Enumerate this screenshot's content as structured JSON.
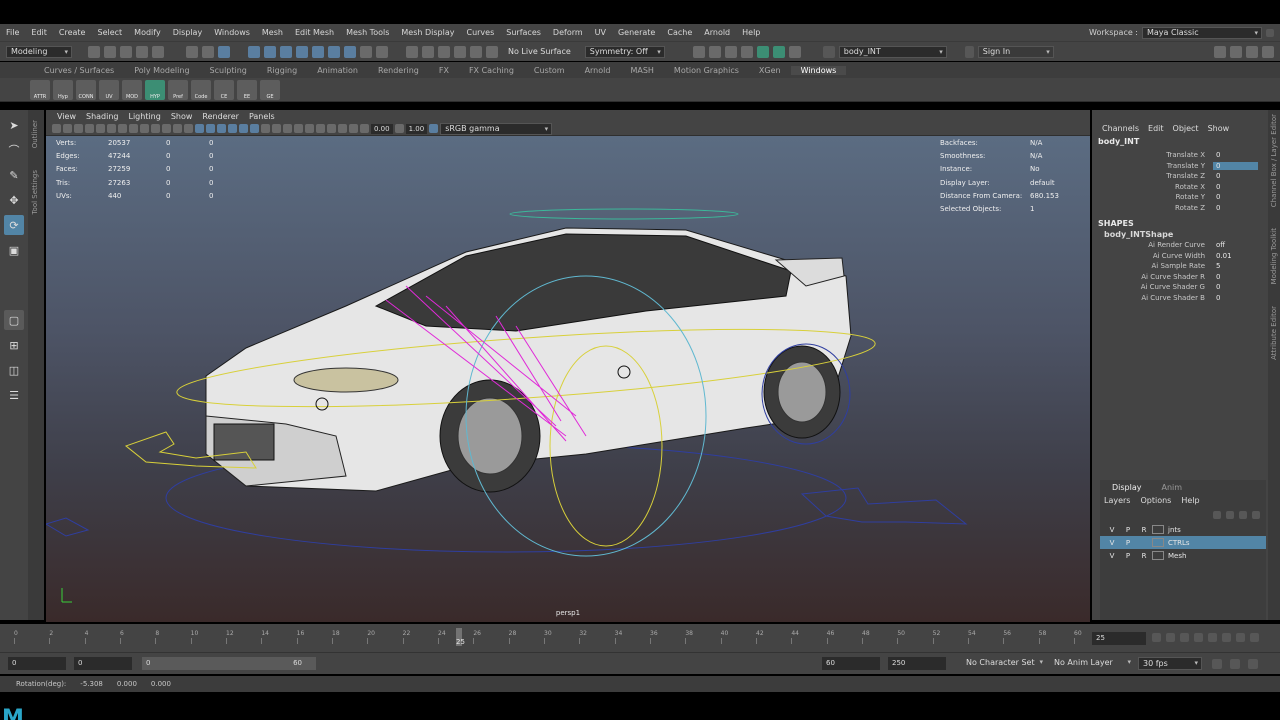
{
  "menu": [
    "File",
    "Edit",
    "Create",
    "Select",
    "Modify",
    "Display",
    "Windows",
    "Mesh",
    "Edit Mesh",
    "Mesh Tools",
    "Mesh Display",
    "Curves",
    "Surfaces",
    "Deform",
    "UV",
    "Generate",
    "Cache",
    "Arnold",
    "Help"
  ],
  "workspace": {
    "label": "Workspace :",
    "value": "Maya Classic"
  },
  "status": {
    "mode": "Modeling",
    "live_surface": "No Live Surface",
    "symmetry": "Symmetry: Off",
    "object_name": "body_INT",
    "sign_in": "Sign In"
  },
  "shelf_tabs": [
    "Curves / Surfaces",
    "Poly Modeling",
    "Sculpting",
    "Rigging",
    "Animation",
    "Rendering",
    "FX",
    "FX Caching",
    "Custom",
    "Arnold",
    "MASH",
    "Motion Graphics",
    "XGen",
    "Windows"
  ],
  "shelf_active": "Windows",
  "shelf_icons": [
    "ATTR",
    "Hyp",
    "CONN",
    "UV",
    "MOD",
    "HYP",
    "Pref",
    "Code",
    "CE",
    "EE",
    "GE"
  ],
  "side_labels": {
    "outliner": "Outliner",
    "tool_settings": "Tool Settings"
  },
  "viewport": {
    "menu": [
      "View",
      "Shading",
      "Lighting",
      "Show",
      "Renderer",
      "Panels"
    ],
    "near": "0.00",
    "far": "1.00",
    "color_space": "sRGB gamma",
    "camera": "persp1",
    "stats": [
      {
        "k": "Verts:",
        "a": "20537",
        "b": "0",
        "c": "0"
      },
      {
        "k": "Edges:",
        "a": "47244",
        "b": "0",
        "c": "0"
      },
      {
        "k": "Faces:",
        "a": "27259",
        "b": "0",
        "c": "0"
      },
      {
        "k": "Tris:",
        "a": "27263",
        "b": "0",
        "c": "0"
      },
      {
        "k": "UVs:",
        "a": "440",
        "b": "0",
        "c": "0"
      }
    ],
    "info": [
      {
        "k": "Backfaces:",
        "v": "N/A"
      },
      {
        "k": "Smoothness:",
        "v": "N/A"
      },
      {
        "k": "Instance:",
        "v": "No"
      },
      {
        "k": "Display Layer:",
        "v": "default"
      },
      {
        "k": "Distance From Camera:",
        "v": "680.153"
      },
      {
        "k": "Selected Objects:",
        "v": "1"
      }
    ]
  },
  "channel_box": {
    "menu": [
      "Channels",
      "Edit",
      "Object",
      "Show"
    ],
    "node": "body_INT",
    "attrs": [
      {
        "n": "Translate X",
        "v": "0"
      },
      {
        "n": "Translate Y",
        "v": "0"
      },
      {
        "n": "Translate Z",
        "v": "0"
      },
      {
        "n": "Rotate X",
        "v": "0"
      },
      {
        "n": "Rotate Y",
        "v": "0"
      },
      {
        "n": "Rotate Z",
        "v": "0"
      }
    ],
    "shapes_header": "SHAPES",
    "shape_node": "body_INTShape",
    "shape_attrs": [
      {
        "n": "Ai Render Curve",
        "v": "off"
      },
      {
        "n": "Ai Curve Width",
        "v": "0.01"
      },
      {
        "n": "Ai Sample Rate",
        "v": "5"
      },
      {
        "n": "Ai Curve Shader R",
        "v": "0"
      },
      {
        "n": "Ai Curve Shader G",
        "v": "0"
      },
      {
        "n": "Ai Curve Shader B",
        "v": "0"
      }
    ]
  },
  "right_tabs": [
    "Channel Box / Layer Editor",
    "Modeling Toolkit",
    "Attribute Editor"
  ],
  "layers": {
    "tabs": [
      "Display",
      "Anim"
    ],
    "menu": [
      "Layers",
      "Options",
      "Help"
    ],
    "rows": [
      {
        "v": "V",
        "p": "P",
        "r": "R",
        "name": "jnts",
        "selected": false
      },
      {
        "v": "V",
        "p": "P",
        "r": "",
        "name": "CTRLs",
        "selected": true
      },
      {
        "v": "V",
        "p": "P",
        "r": "R",
        "name": "Mesh",
        "selected": false
      }
    ]
  },
  "timeline": {
    "ticks": [
      "0",
      "2",
      "4",
      "6",
      "8",
      "10",
      "12",
      "14",
      "16",
      "18",
      "20",
      "22",
      "24",
      "26",
      "28",
      "30",
      "32",
      "34",
      "36",
      "38",
      "40",
      "42",
      "44",
      "46",
      "48",
      "50",
      "52",
      "54",
      "56",
      "58",
      "60"
    ],
    "current": "25",
    "current_field": "25"
  },
  "range": {
    "start": "0",
    "playback_start": "0",
    "slider_start": "0",
    "slider_end": "60",
    "playback_end": "60",
    "end": "250",
    "character_set": "No Character Set",
    "anim_layer": "No Anim Layer",
    "fps": "30 fps"
  },
  "help_line": {
    "label": "Rotation(deg):",
    "x": "-5.308",
    "y": "0.000",
    "z": "0.000"
  },
  "colors": {
    "accent": "#5285a6",
    "panel": "#444444",
    "viewport_top": "#5b6c82"
  }
}
